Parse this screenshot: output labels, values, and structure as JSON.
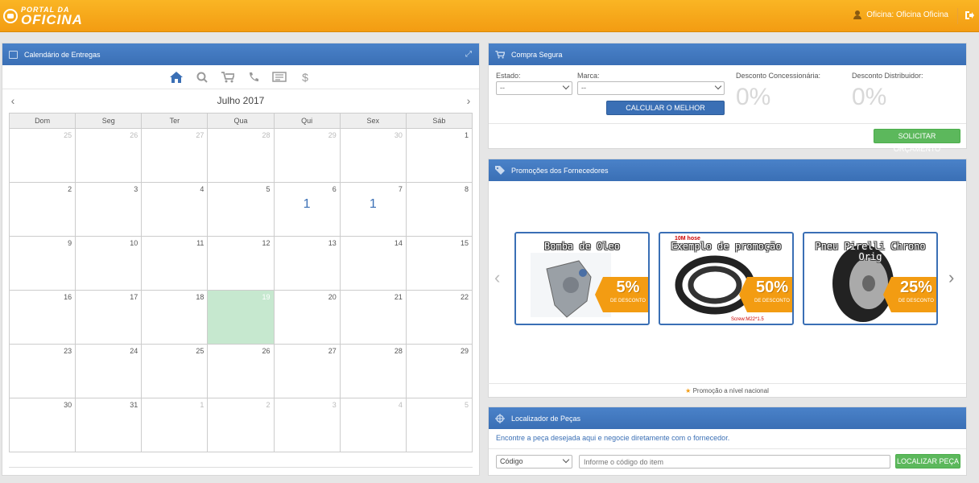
{
  "header": {
    "logo_line1": "PORTAL DA",
    "logo_line2": "OFICINA",
    "user_label": "Oficina: Oficina Oficina"
  },
  "calendar": {
    "title": "Calendário de Entregas",
    "month": "Julho 2017",
    "weekdays": [
      "Dom",
      "Seg",
      "Ter",
      "Qua",
      "Qui",
      "Sex",
      "Sáb"
    ],
    "weeks": [
      [
        {
          "d": "25",
          "o": true
        },
        {
          "d": "26",
          "o": true
        },
        {
          "d": "27",
          "o": true
        },
        {
          "d": "28",
          "o": true
        },
        {
          "d": "29",
          "o": true
        },
        {
          "d": "30",
          "o": true
        },
        {
          "d": "1"
        }
      ],
      [
        {
          "d": "2"
        },
        {
          "d": "3"
        },
        {
          "d": "4"
        },
        {
          "d": "5"
        },
        {
          "d": "6",
          "e": "1"
        },
        {
          "d": "7",
          "e": "1"
        },
        {
          "d": "8"
        }
      ],
      [
        {
          "d": "9"
        },
        {
          "d": "10"
        },
        {
          "d": "11"
        },
        {
          "d": "12"
        },
        {
          "d": "13"
        },
        {
          "d": "14"
        },
        {
          "d": "15"
        }
      ],
      [
        {
          "d": "16"
        },
        {
          "d": "17"
        },
        {
          "d": "18"
        },
        {
          "d": "19",
          "t": true
        },
        {
          "d": "20"
        },
        {
          "d": "21"
        },
        {
          "d": "22"
        }
      ],
      [
        {
          "d": "23"
        },
        {
          "d": "24"
        },
        {
          "d": "25"
        },
        {
          "d": "26"
        },
        {
          "d": "27"
        },
        {
          "d": "28"
        },
        {
          "d": "29"
        }
      ],
      [
        {
          "d": "30"
        },
        {
          "d": "31"
        },
        {
          "d": "1",
          "o": true
        },
        {
          "d": "2",
          "o": true
        },
        {
          "d": "3",
          "o": true
        },
        {
          "d": "4",
          "o": true
        },
        {
          "d": "5",
          "o": true
        }
      ]
    ]
  },
  "compra": {
    "title": "Compra Segura",
    "estado_label": "Estado:",
    "estado_value": "--",
    "marca_label": "Marca:",
    "marca_value": "--",
    "calc_button": "CALCULAR O MELHOR DESCONTO",
    "desc_conc_label": "Desconto Concessionária:",
    "desc_conc_value": "0%",
    "desc_dist_label": "Desconto Distribuidor:",
    "desc_dist_value": "0%",
    "orcamento_button": "SOLICITAR ORÇAMENTO"
  },
  "promos": {
    "title": "Promoções dos Fornecedores",
    "items": [
      {
        "name": "Bomba de Oleo",
        "pct": "5%",
        "tag": "DE DESCONTO"
      },
      {
        "name": "Exemplo de promoção",
        "pct": "50%",
        "tag": "DE DESCONTO"
      },
      {
        "name": "Pneu Pirelli Chrono Orig",
        "pct": "25%",
        "tag": "DE DESCONTO"
      }
    ],
    "hose_label": "10M hose",
    "screw_label": "Screw:M22*1.5",
    "national": "Promoção a nível nacional"
  },
  "localizador": {
    "title": "Localizador de Peças",
    "subtitle": "Encontre a peça desejada aqui e negocie diretamente com o fornecedor.",
    "type_value": "Código",
    "input_placeholder": "Informe o código do item",
    "button": "LOCALIZAR PEÇA"
  }
}
